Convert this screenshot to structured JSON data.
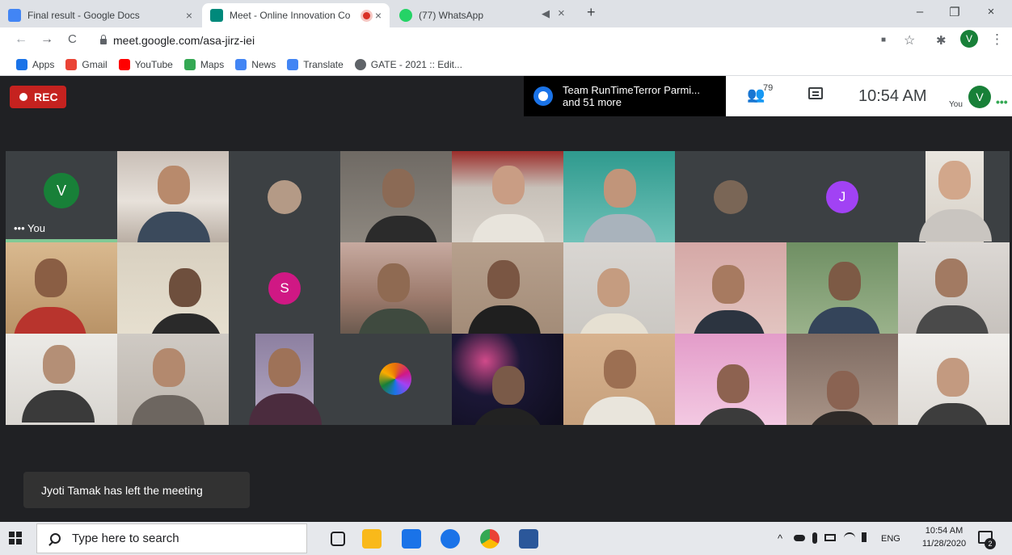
{
  "browser": {
    "tabs": [
      {
        "title": "Final result - Google Docs",
        "close": "×",
        "color": "#4285f4"
      },
      {
        "title": "Meet - Online Innovation Co",
        "close": "×",
        "color": "#00897b",
        "recording": true
      },
      {
        "title": "(77) WhatsApp",
        "color": "#25d366"
      }
    ],
    "tab_extras": {
      "mute": "◀",
      "close": "×",
      "new_tab": "+"
    },
    "window": {
      "minimize": "–",
      "restore": "❐",
      "close": "×"
    },
    "nav": {
      "back": "←",
      "forward": "→",
      "reload": "C"
    },
    "url": "meet.google.com/asa-jirz-iei",
    "toolbar_icons": {
      "camera": "■",
      "star": "☆",
      "extensions": "✱",
      "menu": "⋮"
    },
    "profile_initial": "V",
    "bookmarks": [
      {
        "label": "Apps",
        "color": "#1a73e8"
      },
      {
        "label": "Gmail",
        "color": "#ea4335"
      },
      {
        "label": "YouTube",
        "color": "#ff0000"
      },
      {
        "label": "Maps",
        "color": "#34a853"
      },
      {
        "label": "News",
        "color": "#4285f4"
      },
      {
        "label": "Translate",
        "color": "#4285f4"
      },
      {
        "label": "GATE - 2021 :: Edit...",
        "color": "#5f6368"
      }
    ]
  },
  "meet": {
    "rec_label": "REC",
    "presenter_line1": "Team RunTimeTerror Parmi...",
    "presenter_line2": "and 51 more",
    "people_icon": "👥",
    "people_count": "79",
    "clock": "10:54 AM",
    "you_label": "You",
    "you_initial": "V",
    "you_dots": "•••",
    "self_tile": {
      "initial": "V",
      "name": "••• You"
    },
    "letter_avatars": {
      "j": "J",
      "s": "S"
    },
    "toast": "Jyoti Tamak has left the meeting",
    "colors": {
      "rec": "#c5221f",
      "you_avatar": "#188038",
      "j_avatar": "#a142f4",
      "s_avatar": "#d01884",
      "speaking": "#81c995"
    }
  },
  "taskbar": {
    "search_placeholder": "Type here to search",
    "tray": {
      "chevron": "^",
      "lang": "ENG",
      "time": "10:54 AM",
      "date": "11/28/2020",
      "notifications": "2"
    }
  }
}
